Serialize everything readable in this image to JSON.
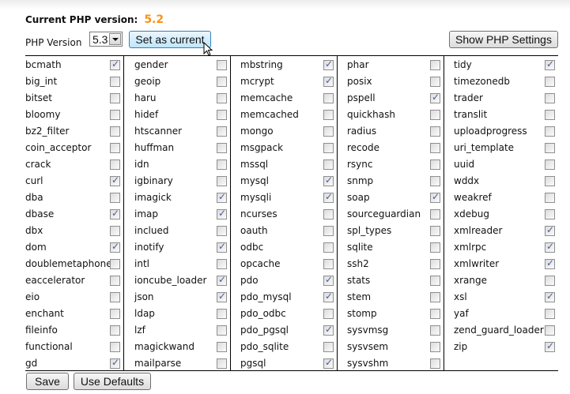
{
  "current_label": "Current PHP version:",
  "current_version": "5.2",
  "version_label": "PHP Version",
  "version_select": "5.3",
  "set_current": "Set as current",
  "show_settings": "Show PHP Settings",
  "save": "Save",
  "use_defaults": "Use Defaults",
  "columns": [
    [
      [
        "bcmath",
        true
      ],
      [
        "big_int",
        false
      ],
      [
        "bitset",
        false
      ],
      [
        "bloomy",
        false
      ],
      [
        "bz2_filter",
        false
      ],
      [
        "coin_acceptor",
        false
      ],
      [
        "crack",
        false
      ],
      [
        "curl",
        true
      ],
      [
        "dba",
        false
      ],
      [
        "dbase",
        true
      ],
      [
        "dbx",
        false
      ],
      [
        "dom",
        true
      ],
      [
        "doublemetaphone",
        false
      ],
      [
        "eaccelerator",
        false
      ],
      [
        "eio",
        false
      ],
      [
        "enchant",
        false
      ],
      [
        "fileinfo",
        false
      ],
      [
        "functional",
        false
      ],
      [
        "gd",
        true
      ]
    ],
    [
      [
        "gender",
        false
      ],
      [
        "geoip",
        false
      ],
      [
        "haru",
        false
      ],
      [
        "hidef",
        false
      ],
      [
        "htscanner",
        false
      ],
      [
        "huffman",
        false
      ],
      [
        "idn",
        false
      ],
      [
        "igbinary",
        false
      ],
      [
        "imagick",
        true
      ],
      [
        "imap",
        true
      ],
      [
        "inclued",
        false
      ],
      [
        "inotify",
        true
      ],
      [
        "intl",
        false
      ],
      [
        "ioncube_loader",
        true
      ],
      [
        "json",
        true
      ],
      [
        "ldap",
        false
      ],
      [
        "lzf",
        false
      ],
      [
        "magickwand",
        false
      ],
      [
        "mailparse",
        false
      ]
    ],
    [
      [
        "mbstring",
        true
      ],
      [
        "mcrypt",
        true
      ],
      [
        "memcache",
        false
      ],
      [
        "memcached",
        false
      ],
      [
        "mongo",
        false
      ],
      [
        "msgpack",
        false
      ],
      [
        "mssql",
        false
      ],
      [
        "mysql",
        true
      ],
      [
        "mysqli",
        true
      ],
      [
        "ncurses",
        false
      ],
      [
        "oauth",
        false
      ],
      [
        "odbc",
        false
      ],
      [
        "opcache",
        false
      ],
      [
        "pdo",
        true
      ],
      [
        "pdo_mysql",
        true
      ],
      [
        "pdo_odbc",
        false
      ],
      [
        "pdo_pgsql",
        true
      ],
      [
        "pdo_sqlite",
        false
      ],
      [
        "pgsql",
        true
      ]
    ],
    [
      [
        "phar",
        false
      ],
      [
        "posix",
        false
      ],
      [
        "pspell",
        true
      ],
      [
        "quickhash",
        false
      ],
      [
        "radius",
        false
      ],
      [
        "recode",
        false
      ],
      [
        "rsync",
        false
      ],
      [
        "snmp",
        false
      ],
      [
        "soap",
        true
      ],
      [
        "sourceguardian",
        false
      ],
      [
        "spl_types",
        false
      ],
      [
        "sqlite",
        false
      ],
      [
        "ssh2",
        false
      ],
      [
        "stats",
        false
      ],
      [
        "stem",
        false
      ],
      [
        "stomp",
        false
      ],
      [
        "sysvmsg",
        false
      ],
      [
        "sysvsem",
        false
      ],
      [
        "sysvshm",
        false
      ]
    ],
    [
      [
        "tidy",
        true
      ],
      [
        "timezonedb",
        false
      ],
      [
        "trader",
        false
      ],
      [
        "translit",
        false
      ],
      [
        "uploadprogress",
        false
      ],
      [
        "uri_template",
        false
      ],
      [
        "uuid",
        false
      ],
      [
        "wddx",
        false
      ],
      [
        "weakref",
        false
      ],
      [
        "xdebug",
        false
      ],
      [
        "xmlreader",
        true
      ],
      [
        "xmlrpc",
        true
      ],
      [
        "xmlwriter",
        true
      ],
      [
        "xrange",
        false
      ],
      [
        "xsl",
        true
      ],
      [
        "yaf",
        false
      ],
      [
        "zend_guard_loader",
        false
      ],
      [
        "zip",
        true
      ]
    ]
  ]
}
